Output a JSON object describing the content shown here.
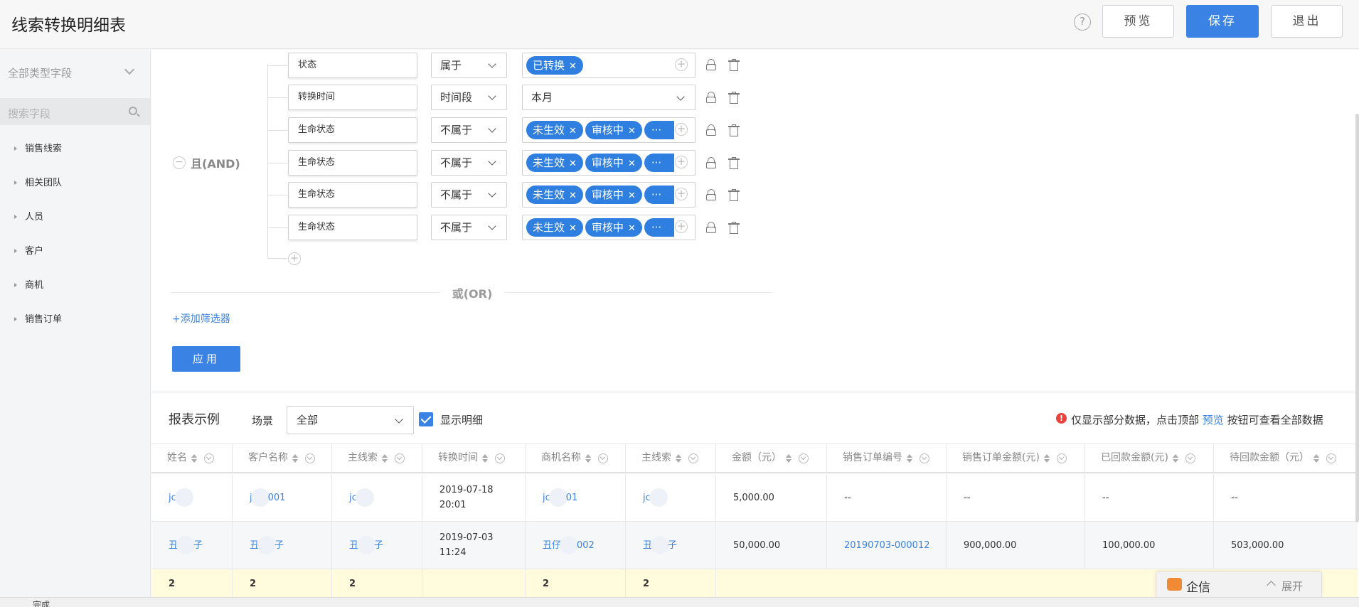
{
  "header": {
    "title": "线索转换明细表",
    "help": "?",
    "preview_label": "预览",
    "save_label": "保存",
    "exit_label": "退出"
  },
  "sidebar": {
    "type_select": "全部类型字段",
    "search_placeholder": "搜索字段",
    "items": [
      "销售线索",
      "相关团队",
      "人员",
      "客户",
      "商机",
      "销售订单"
    ]
  },
  "filter": {
    "and_label": "且(AND)",
    "or_label": "或(OR)",
    "add_filter": "+添加筛选器",
    "apply": "应用",
    "conditions": [
      {
        "field": "状态",
        "op": "属于",
        "tags": [
          "已转换"
        ]
      },
      {
        "field": "转换时间",
        "op": "时间段",
        "value": "本月"
      },
      {
        "field": "生命状态",
        "op": "不属于",
        "tags": [
          "未生效",
          "审核中"
        ],
        "more": "···"
      },
      {
        "field": "生命状态",
        "op": "不属于",
        "tags": [
          "未生效",
          "审核中"
        ],
        "more": "···"
      },
      {
        "field": "生命状态",
        "op": "不属于",
        "tags": [
          "未生效",
          "审核中"
        ],
        "more": "···"
      },
      {
        "field": "生命状态",
        "op": "不属于",
        "tags": [
          "未生效",
          "审核中"
        ],
        "more": "···"
      }
    ]
  },
  "report": {
    "title": "报表示例",
    "scene_label": "场景",
    "scene_value": "全部",
    "show_detail": "显示明细",
    "notice_prefix": "仅显示部分数据，点击顶部",
    "notice_link": "预览",
    "notice_suffix": "按钮可查看全部数据",
    "columns": [
      "姓名",
      "客户名称",
      "主线索",
      "转换时间",
      "商机名称",
      "主线索",
      "金额（元）",
      "销售订单编号",
      "销售订单金额(元)",
      "已回款金额(元)",
      "待回款金额（元）"
    ],
    "rows": [
      [
        "jc",
        "j",
        "001",
        "jc",
        "2019-07-18",
        "20:01",
        "jc",
        "01",
        "jc",
        "5,000.00",
        "--",
        "--",
        "--",
        "--"
      ],
      [
        "丑",
        "子",
        "丑",
        "子",
        "丑",
        "子",
        "2019-07-03",
        "11:24",
        "丑仔",
        "002",
        "丑",
        "子",
        "50,000.00",
        "20190703-000012",
        "900,000.00",
        "100,000.00",
        "503,000.00"
      ]
    ],
    "totals": [
      "2",
      "2",
      "2",
      "2",
      "2"
    ]
  },
  "widget": {
    "qixin_label": "企信",
    "expand_label": "展开"
  },
  "status": {
    "text": "完成"
  }
}
